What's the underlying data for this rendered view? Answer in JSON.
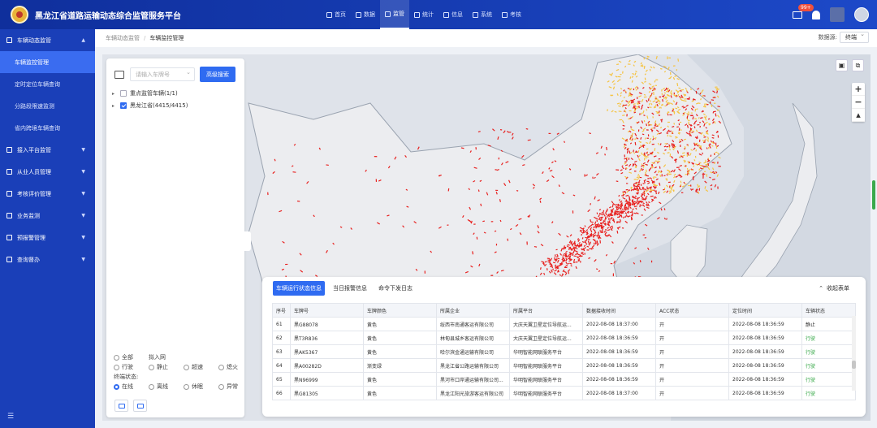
{
  "header": {
    "title": "黑龙江省道路运输动态综合监管服务平台",
    "nav": [
      {
        "label": "首页",
        "icon": "home-icon"
      },
      {
        "label": "数据",
        "icon": "bar-chart-icon"
      },
      {
        "label": "监管",
        "icon": "monitor-icon"
      },
      {
        "label": "统计",
        "icon": "pie-chart-icon"
      },
      {
        "label": "信息",
        "icon": "mail-icon"
      },
      {
        "label": "系统",
        "icon": "gear-icon"
      },
      {
        "label": "考核",
        "icon": "checklist-icon"
      }
    ],
    "active_nav": "监管",
    "notification_count": "99+"
  },
  "sidebar": {
    "groups": [
      {
        "label": "车辆动态监管",
        "expanded": true,
        "icon": "shield-icon",
        "items": [
          "车辆监控管理",
          "定时定位车辆查询",
          "分路段限速监测",
          "省内跨境车辆查询"
        ]
      },
      {
        "label": "接入平台监管",
        "icon": "platform-icon"
      },
      {
        "label": "从业人员管理",
        "icon": "people-icon"
      },
      {
        "label": "考核评价管理",
        "icon": "evaluation-icon"
      },
      {
        "label": "业务监测",
        "icon": "monitor-icon"
      },
      {
        "label": "预报警管理",
        "icon": "alarm-icon"
      },
      {
        "label": "查询督办",
        "icon": "query-icon"
      }
    ],
    "active_item": "车辆监控管理"
  },
  "breadcrumb": {
    "parent": "车辆动态监管",
    "current": "车辆监控管理"
  },
  "data_source": {
    "label": "数据源:",
    "value": "终端"
  },
  "tree_panel": {
    "search_placeholder": "请输入车牌号",
    "advanced_search_label": "高级搜索",
    "nodes": [
      {
        "label": "重点监管车辆(1/1)",
        "checked": false
      },
      {
        "label": "黑龙江省(4415/4415)",
        "checked": true
      }
    ],
    "filters": {
      "row1": [
        "全部",
        "拟入网"
      ],
      "row2": [
        "行驶",
        "静止",
        "超速",
        "熄火"
      ],
      "status_label": "终端状态:",
      "row3": [
        "在线",
        "离线",
        "休眠",
        "异常"
      ]
    }
  },
  "table_panel": {
    "tabs": [
      "车辆运行状态信息",
      "当日报警信息",
      "命令下发日志"
    ],
    "active_tab": "车辆运行状态信息",
    "collapse_label": "收起表单",
    "columns": [
      "序号",
      "车牌号",
      "车牌颜色",
      "所属企业",
      "所属平台",
      "数据接收时间",
      "ACC状态",
      "定位时间",
      "车辆状态"
    ],
    "rows": [
      [
        "61",
        "黑G88078",
        "黄色",
        "绥西市南通客运有限公司",
        "大庆天翼卫星定位导航运...",
        "2022-08-08 18:37:00",
        "开",
        "2022-08-08 18:36:59",
        "静止"
      ],
      [
        "62",
        "黑T3R836",
        "黄色",
        "林甸县城乡客运有限公司",
        "大庆天翼卫星定位导航运...",
        "2022-08-08 18:36:59",
        "开",
        "2022-08-08 18:36:59",
        "行驶"
      ],
      [
        "63",
        "黑AK5367",
        "黄色",
        "哈尔滨金通运输有限公司",
        "华明智能网联服务平台",
        "2022-08-08 18:36:59",
        "开",
        "2022-08-08 18:36:59",
        "行驶"
      ],
      [
        "64",
        "黑A00282D",
        "渐变绿",
        "黑龙江省公路运输有限公司",
        "华明智能网联服务平台",
        "2022-08-08 18:36:59",
        "开",
        "2022-08-08 18:36:59",
        "行驶"
      ],
      [
        "65",
        "黑N96999",
        "黄色",
        "黑河市口岸通运输有限公司...",
        "华明智能网联服务平台",
        "2022-08-08 18:36:59",
        "开",
        "2022-08-08 18:36:59",
        "行驶"
      ],
      [
        "66",
        "黑G81305",
        "黄色",
        "黑龙江阳光旅游客运有限公司",
        "华明智能网联服务平台",
        "2022-08-08 18:37:00",
        "开",
        "2022-08-08 18:36:59",
        "行驶"
      ]
    ]
  },
  "colors": {
    "primary": "#2f6bf1",
    "sidebar": "#1a3fb8",
    "header": "#0f2f9c",
    "vehicle_dense": "#e8211f",
    "vehicle_cluster": "#f5c443",
    "moving": "#3aa94b"
  }
}
